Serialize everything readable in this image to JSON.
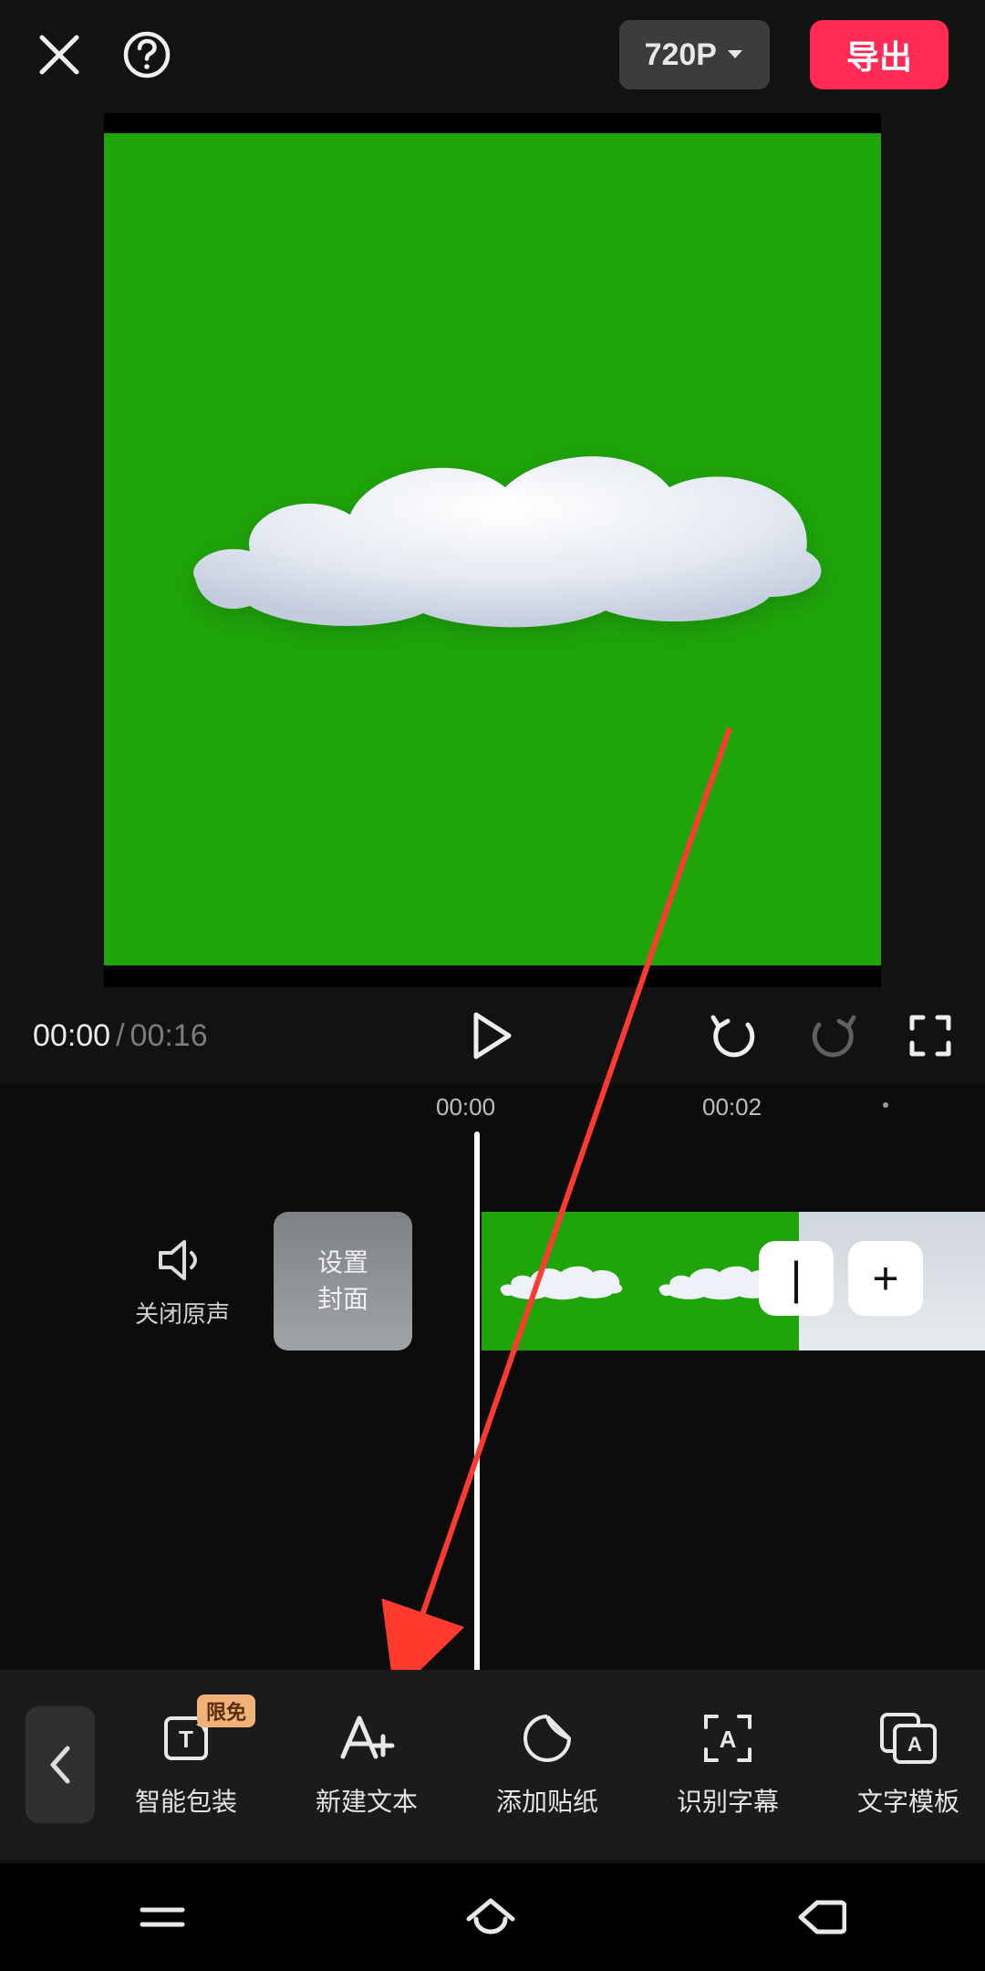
{
  "top": {
    "resolution": "720P",
    "export": "导出"
  },
  "play": {
    "current": "00:00",
    "duration": "00:16"
  },
  "ruler": {
    "marks": [
      "00:00",
      "00:02"
    ]
  },
  "timeline": {
    "mute_label": "关闭原声",
    "cover_label_l1": "设置",
    "cover_label_l2": "封面",
    "minus": "|",
    "plus": "+"
  },
  "tools": {
    "badge": "限免",
    "items": [
      {
        "label": "智能包装"
      },
      {
        "label": "新建文本"
      },
      {
        "label": "添加贴纸"
      },
      {
        "label": "识别字幕"
      },
      {
        "label": "文字模板"
      }
    ]
  },
  "icons": {
    "close": "close-icon",
    "help": "help-icon",
    "play": "play-icon",
    "undo": "undo-icon",
    "redo": "redo-icon",
    "fullscreen": "fullscreen-icon",
    "speaker": "speaker-icon",
    "back": "back-icon"
  }
}
